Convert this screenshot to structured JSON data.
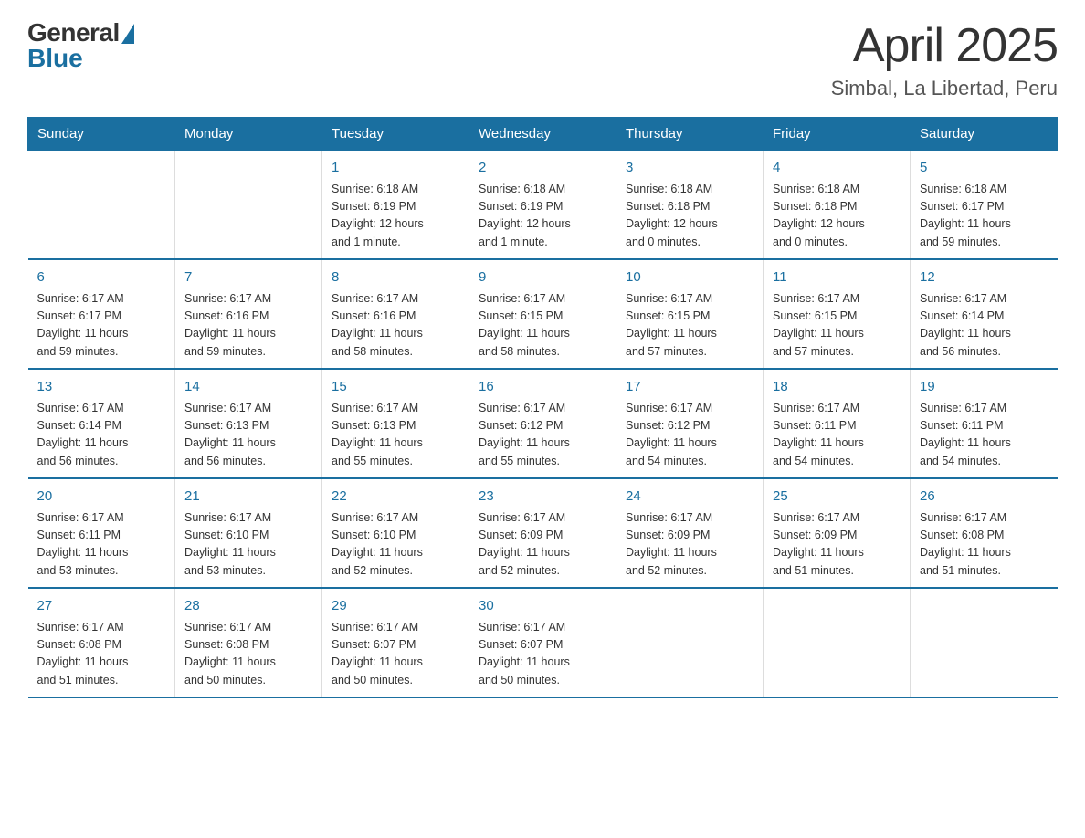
{
  "header": {
    "logo_general": "General",
    "logo_blue": "Blue",
    "title": "April 2025",
    "location": "Simbal, La Libertad, Peru"
  },
  "days_of_week": [
    "Sunday",
    "Monday",
    "Tuesday",
    "Wednesday",
    "Thursday",
    "Friday",
    "Saturday"
  ],
  "weeks": [
    [
      {
        "day": "",
        "info": ""
      },
      {
        "day": "",
        "info": ""
      },
      {
        "day": "1",
        "info": "Sunrise: 6:18 AM\nSunset: 6:19 PM\nDaylight: 12 hours\nand 1 minute."
      },
      {
        "day": "2",
        "info": "Sunrise: 6:18 AM\nSunset: 6:19 PM\nDaylight: 12 hours\nand 1 minute."
      },
      {
        "day": "3",
        "info": "Sunrise: 6:18 AM\nSunset: 6:18 PM\nDaylight: 12 hours\nand 0 minutes."
      },
      {
        "day": "4",
        "info": "Sunrise: 6:18 AM\nSunset: 6:18 PM\nDaylight: 12 hours\nand 0 minutes."
      },
      {
        "day": "5",
        "info": "Sunrise: 6:18 AM\nSunset: 6:17 PM\nDaylight: 11 hours\nand 59 minutes."
      }
    ],
    [
      {
        "day": "6",
        "info": "Sunrise: 6:17 AM\nSunset: 6:17 PM\nDaylight: 11 hours\nand 59 minutes."
      },
      {
        "day": "7",
        "info": "Sunrise: 6:17 AM\nSunset: 6:16 PM\nDaylight: 11 hours\nand 59 minutes."
      },
      {
        "day": "8",
        "info": "Sunrise: 6:17 AM\nSunset: 6:16 PM\nDaylight: 11 hours\nand 58 minutes."
      },
      {
        "day": "9",
        "info": "Sunrise: 6:17 AM\nSunset: 6:15 PM\nDaylight: 11 hours\nand 58 minutes."
      },
      {
        "day": "10",
        "info": "Sunrise: 6:17 AM\nSunset: 6:15 PM\nDaylight: 11 hours\nand 57 minutes."
      },
      {
        "day": "11",
        "info": "Sunrise: 6:17 AM\nSunset: 6:15 PM\nDaylight: 11 hours\nand 57 minutes."
      },
      {
        "day": "12",
        "info": "Sunrise: 6:17 AM\nSunset: 6:14 PM\nDaylight: 11 hours\nand 56 minutes."
      }
    ],
    [
      {
        "day": "13",
        "info": "Sunrise: 6:17 AM\nSunset: 6:14 PM\nDaylight: 11 hours\nand 56 minutes."
      },
      {
        "day": "14",
        "info": "Sunrise: 6:17 AM\nSunset: 6:13 PM\nDaylight: 11 hours\nand 56 minutes."
      },
      {
        "day": "15",
        "info": "Sunrise: 6:17 AM\nSunset: 6:13 PM\nDaylight: 11 hours\nand 55 minutes."
      },
      {
        "day": "16",
        "info": "Sunrise: 6:17 AM\nSunset: 6:12 PM\nDaylight: 11 hours\nand 55 minutes."
      },
      {
        "day": "17",
        "info": "Sunrise: 6:17 AM\nSunset: 6:12 PM\nDaylight: 11 hours\nand 54 minutes."
      },
      {
        "day": "18",
        "info": "Sunrise: 6:17 AM\nSunset: 6:11 PM\nDaylight: 11 hours\nand 54 minutes."
      },
      {
        "day": "19",
        "info": "Sunrise: 6:17 AM\nSunset: 6:11 PM\nDaylight: 11 hours\nand 54 minutes."
      }
    ],
    [
      {
        "day": "20",
        "info": "Sunrise: 6:17 AM\nSunset: 6:11 PM\nDaylight: 11 hours\nand 53 minutes."
      },
      {
        "day": "21",
        "info": "Sunrise: 6:17 AM\nSunset: 6:10 PM\nDaylight: 11 hours\nand 53 minutes."
      },
      {
        "day": "22",
        "info": "Sunrise: 6:17 AM\nSunset: 6:10 PM\nDaylight: 11 hours\nand 52 minutes."
      },
      {
        "day": "23",
        "info": "Sunrise: 6:17 AM\nSunset: 6:09 PM\nDaylight: 11 hours\nand 52 minutes."
      },
      {
        "day": "24",
        "info": "Sunrise: 6:17 AM\nSunset: 6:09 PM\nDaylight: 11 hours\nand 52 minutes."
      },
      {
        "day": "25",
        "info": "Sunrise: 6:17 AM\nSunset: 6:09 PM\nDaylight: 11 hours\nand 51 minutes."
      },
      {
        "day": "26",
        "info": "Sunrise: 6:17 AM\nSunset: 6:08 PM\nDaylight: 11 hours\nand 51 minutes."
      }
    ],
    [
      {
        "day": "27",
        "info": "Sunrise: 6:17 AM\nSunset: 6:08 PM\nDaylight: 11 hours\nand 51 minutes."
      },
      {
        "day": "28",
        "info": "Sunrise: 6:17 AM\nSunset: 6:08 PM\nDaylight: 11 hours\nand 50 minutes."
      },
      {
        "day": "29",
        "info": "Sunrise: 6:17 AM\nSunset: 6:07 PM\nDaylight: 11 hours\nand 50 minutes."
      },
      {
        "day": "30",
        "info": "Sunrise: 6:17 AM\nSunset: 6:07 PM\nDaylight: 11 hours\nand 50 minutes."
      },
      {
        "day": "",
        "info": ""
      },
      {
        "day": "",
        "info": ""
      },
      {
        "day": "",
        "info": ""
      }
    ]
  ]
}
